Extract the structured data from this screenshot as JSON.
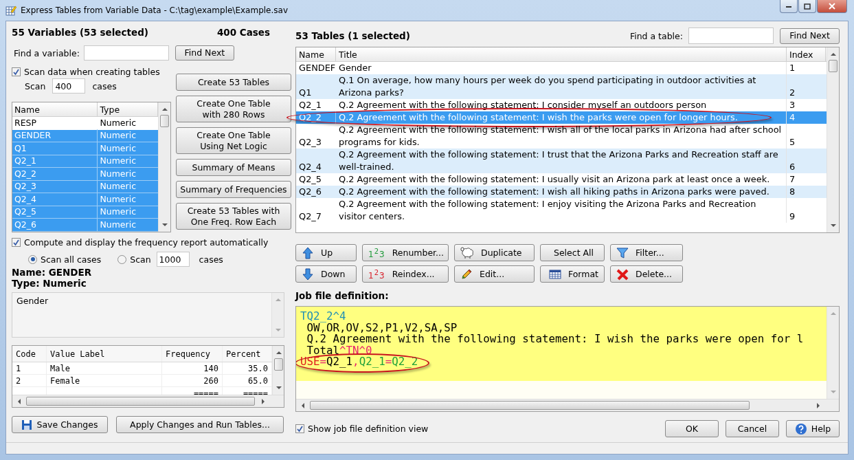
{
  "window": {
    "title": "Express Tables from Variable Data - C:\\tag\\example\\Example.sav"
  },
  "variables_panel": {
    "heading": "55 Variables  (53 selected)",
    "cases": "400 Cases",
    "find_label": "Find a variable:",
    "find_button": "Find Next",
    "scan_checkbox": {
      "label": "Scan data when creating tables",
      "checked": true
    },
    "scan_prefix": "Scan",
    "scan_value": "400",
    "scan_suffix": "cases",
    "columns": [
      "Name",
      "Type"
    ],
    "rows": [
      {
        "name": "RESP",
        "type": "Numeric",
        "selected": false
      },
      {
        "name": "GENDER",
        "type": "Numeric",
        "selected": true
      },
      {
        "name": "Q1",
        "type": "Numeric",
        "selected": true
      },
      {
        "name": "Q2_1",
        "type": "Numeric",
        "selected": true
      },
      {
        "name": "Q2_2",
        "type": "Numeric",
        "selected": true
      },
      {
        "name": "Q2_3",
        "type": "Numeric",
        "selected": true
      },
      {
        "name": "Q2_4",
        "type": "Numeric",
        "selected": true
      },
      {
        "name": "Q2_5",
        "type": "Numeric",
        "selected": true
      },
      {
        "name": "Q2_6",
        "type": "Numeric",
        "selected": true
      }
    ]
  },
  "action_buttons": [
    "Create 53 Tables",
    "Create One Table\nwith 280 Rows",
    "Create One Table\nUsing Net Logic",
    "Summary of Means",
    "Summary of Frequencies",
    "Create 53 Tables with\nOne Freq. Row Each"
  ],
  "frequency": {
    "checkbox": {
      "label": "Compute and display the frequency report automatically",
      "checked": true
    },
    "radios": [
      {
        "label": "Scan all cases",
        "selected": true
      },
      {
        "label": "Scan",
        "selected": false
      }
    ],
    "scan_value": "1000",
    "scan_suffix": "cases",
    "name_line": "Name: GENDER",
    "type_line": "Type: Numeric",
    "label_text": "Gender",
    "columns": [
      "Code",
      "Value Label",
      "Frequency",
      "Percent"
    ],
    "rows": [
      [
        "1",
        "Male",
        "140",
        "35.0"
      ],
      [
        "2",
        "Female",
        "260",
        "65.0"
      ],
      [
        "",
        "",
        "=====",
        "====="
      ]
    ]
  },
  "bottom_left_buttons": [
    {
      "label": "Save Changes",
      "kind": "save"
    },
    {
      "label": "Apply Changes and Run Tables...",
      "kind": "plain"
    }
  ],
  "tables_panel": {
    "heading": "53 Tables  (1 selected)",
    "find_label": "Find a table:",
    "find_button": "Find Next",
    "columns": [
      "Name",
      "Title",
      "Index"
    ],
    "rows": [
      {
        "name": "GENDEF",
        "title": "Gender",
        "index": "1",
        "selected": false,
        "circled": false
      },
      {
        "name": "Q1",
        "title": "Q.1 On average, how many hours per week do you spend participating in outdoor activities at Arizona parks?",
        "index": "2",
        "selected": false,
        "circled": false
      },
      {
        "name": "Q2_1",
        "title": "Q.2 Agreement with the following statement: I consider myself an outdoors person",
        "index": "3",
        "selected": false,
        "circled": false
      },
      {
        "name": "Q2_2",
        "title": "Q.2 Agreement with the following statement: I wish the parks were open for longer hours.",
        "index": "4",
        "selected": true,
        "circled": true
      },
      {
        "name": "Q2_3",
        "title": "Q.2 Agreement with the following statement: I wish all of the local parks in Arizona had after school programs for kids.",
        "index": "5",
        "selected": false,
        "circled": false
      },
      {
        "name": "Q2_4",
        "title": "Q.2 Agreement with the following statement: I trust that the Arizona Parks and Recreation staff are well-trained.",
        "index": "6",
        "selected": false,
        "circled": false
      },
      {
        "name": "Q2_5",
        "title": "Q.2 Agreement with the following statement: I usually visit an Arizona park at least once a week.",
        "index": "7",
        "selected": false,
        "circled": false
      },
      {
        "name": "Q2_6",
        "title": "Q.2 Agreement with the following statement: I wish all hiking paths in Arizona parks were paved.",
        "index": "8",
        "selected": false,
        "circled": false
      },
      {
        "name": "Q2_7",
        "title": "Q.2 Agreement with the following statement: I enjoy visiting the Arizona Parks and Recreation visitor centers.",
        "index": "9",
        "selected": false,
        "circled": false
      }
    ]
  },
  "table_buttons": [
    {
      "label": "Up",
      "kind": "up"
    },
    {
      "label": "Renumber...",
      "kind": "digits",
      "icon_text": "1$^{2}$3",
      "color": "#1f9a3a"
    },
    {
      "label": "Duplicate",
      "kind": "sheep"
    },
    {
      "label": "Select All",
      "kind": "plain"
    },
    {
      "label": "Filter...",
      "kind": "funnel"
    },
    {
      "label": "Down",
      "kind": "down"
    },
    {
      "label": "Reindex...",
      "kind": "digits",
      "icon_text": "1$^{2}$3",
      "color": "#d8202a"
    },
    {
      "label": "Edit...",
      "kind": "pencil"
    },
    {
      "label": "Format",
      "kind": "grid"
    },
    {
      "label": "Delete...",
      "kind": "delete"
    }
  ],
  "job_definition": {
    "label": "Job file definition:",
    "highlighted": true,
    "lines": [
      {
        "circled": false,
        "segments": [
          {
            "text": "TQ2_2^4",
            "color": "#1f8fb5"
          }
        ]
      },
      {
        "circled": false,
        "segments": [
          {
            "text": " OW,OR,OV,S2,P1,V2,SA,SP",
            "color": "#000000"
          }
        ]
      },
      {
        "circled": false,
        "segments": [
          {
            "text": " Q.2 Agreement with the following statement: I wish the parks were open for l",
            "color": "#000000"
          }
        ]
      },
      {
        "circled": false,
        "segments": [
          {
            "text": " Total",
            "color": "#000000"
          },
          {
            "text": "^TN^0",
            "color": "#e8206e"
          }
        ]
      },
      {
        "circled": true,
        "segments": [
          {
            "text": "USE",
            "color": "#e01c1c"
          },
          {
            "text": "=",
            "color": "#e8206e"
          },
          {
            "text": "Q2_1",
            "color": "#000000"
          },
          {
            "text": ",",
            "color": "#e8206e"
          },
          {
            "text": "Q2_1",
            "color": "#1fa03a"
          },
          {
            "text": "=",
            "color": "#e8206e"
          },
          {
            "text": "Q2_2",
            "color": "#1fa03a"
          }
        ]
      }
    ]
  },
  "show_job_checkbox": {
    "label": "Show job file definition view",
    "checked": true
  },
  "dialog_buttons": [
    {
      "label": "OK",
      "kind": "plain"
    },
    {
      "label": "Cancel",
      "kind": "plain"
    },
    {
      "label": "Help",
      "kind": "help"
    }
  ]
}
